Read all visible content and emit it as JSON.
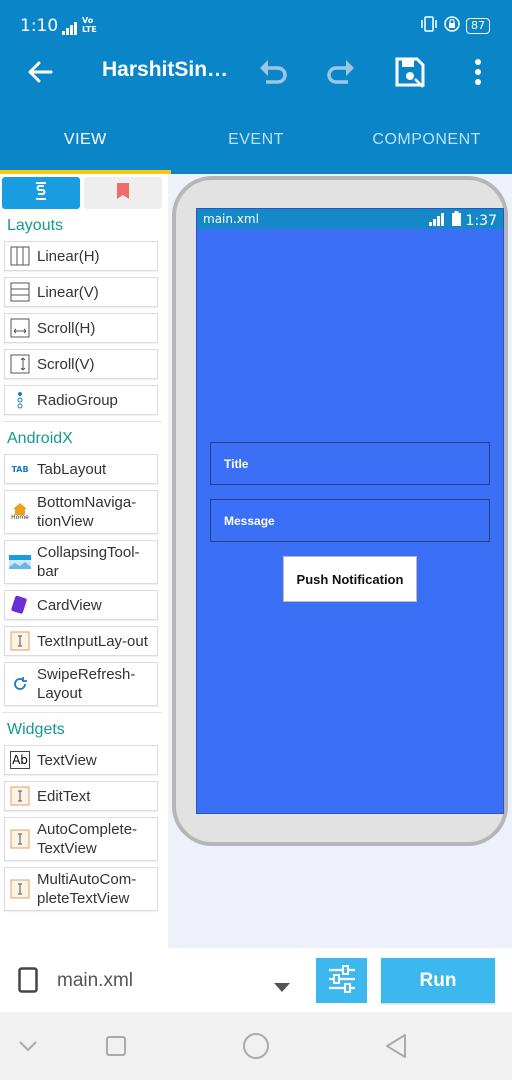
{
  "status_bar": {
    "time": "1:10",
    "network": "Vo LTE",
    "battery": "87"
  },
  "toolbar": {
    "title": "HarshitSin…"
  },
  "tabs": [
    {
      "label": "VIEW"
    },
    {
      "label": "EVENT"
    },
    {
      "label": "COMPONENT"
    }
  ],
  "palette": {
    "layouts_title": "Layouts",
    "layouts": [
      {
        "label": "Linear(H)",
        "icon": "linear-h-icon"
      },
      {
        "label": "Linear(V)",
        "icon": "linear-v-icon"
      },
      {
        "label": "Scroll(H)",
        "icon": "scroll-h-icon"
      },
      {
        "label": "Scroll(V)",
        "icon": "scroll-v-icon"
      },
      {
        "label": "RadioGroup",
        "icon": "radiogroup-icon"
      }
    ],
    "androidx_title": "AndroidX",
    "androidx": [
      {
        "label": "TabLayout",
        "icon_text": "TAB"
      },
      {
        "label": "BottomNaviga-tionView",
        "icon_text": "Home"
      },
      {
        "label": "CollapsingTool-bar"
      },
      {
        "label": "CardView"
      },
      {
        "label": "TextInputLay-out"
      },
      {
        "label": "SwipeRefresh-Layout"
      }
    ],
    "widgets_title": "Widgets",
    "widgets": [
      {
        "label": "TextView",
        "icon_text": "Ab"
      },
      {
        "label": "EditText"
      },
      {
        "label": "AutoComplete-TextView"
      },
      {
        "label": "MultiAutoCom-pleteTextView"
      }
    ]
  },
  "preview": {
    "file_label": "main.xml",
    "time": "1:37",
    "title_field": "Title",
    "message_field": "Message",
    "button_label": "Push Notification"
  },
  "bottom_bar": {
    "file": "main.xml",
    "run_label": "Run"
  },
  "colors": {
    "primary": "#0a86c8",
    "accent": "#f7c515",
    "preview_bg": "#3b6ff5",
    "run": "#3db8ee"
  }
}
